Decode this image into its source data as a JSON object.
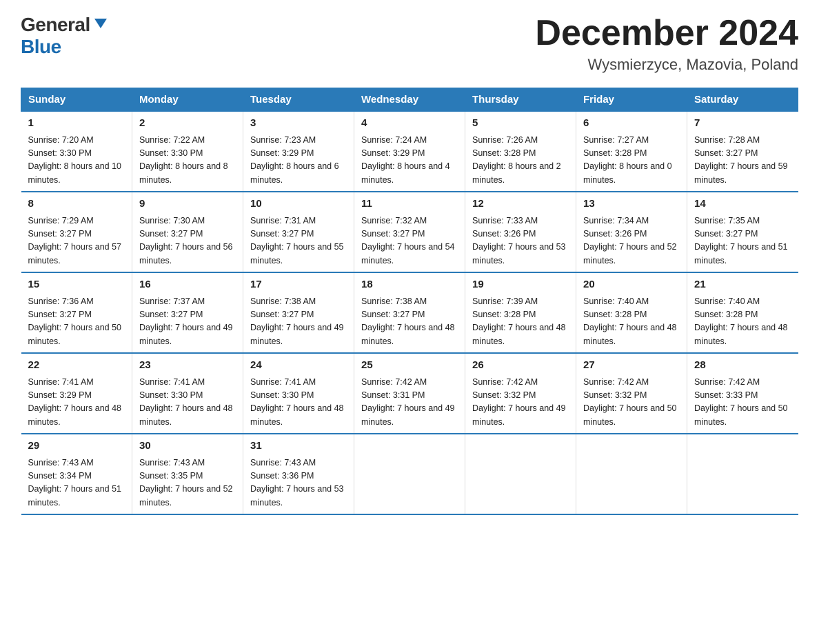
{
  "logo": {
    "general": "General",
    "blue": "Blue"
  },
  "title": "December 2024",
  "location": "Wysmierzyce, Mazovia, Poland",
  "days_of_week": [
    "Sunday",
    "Monday",
    "Tuesday",
    "Wednesday",
    "Thursday",
    "Friday",
    "Saturday"
  ],
  "weeks": [
    [
      {
        "day": "1",
        "sunrise": "Sunrise: 7:20 AM",
        "sunset": "Sunset: 3:30 PM",
        "daylight": "Daylight: 8 hours and 10 minutes."
      },
      {
        "day": "2",
        "sunrise": "Sunrise: 7:22 AM",
        "sunset": "Sunset: 3:30 PM",
        "daylight": "Daylight: 8 hours and 8 minutes."
      },
      {
        "day": "3",
        "sunrise": "Sunrise: 7:23 AM",
        "sunset": "Sunset: 3:29 PM",
        "daylight": "Daylight: 8 hours and 6 minutes."
      },
      {
        "day": "4",
        "sunrise": "Sunrise: 7:24 AM",
        "sunset": "Sunset: 3:29 PM",
        "daylight": "Daylight: 8 hours and 4 minutes."
      },
      {
        "day": "5",
        "sunrise": "Sunrise: 7:26 AM",
        "sunset": "Sunset: 3:28 PM",
        "daylight": "Daylight: 8 hours and 2 minutes."
      },
      {
        "day": "6",
        "sunrise": "Sunrise: 7:27 AM",
        "sunset": "Sunset: 3:28 PM",
        "daylight": "Daylight: 8 hours and 0 minutes."
      },
      {
        "day": "7",
        "sunrise": "Sunrise: 7:28 AM",
        "sunset": "Sunset: 3:27 PM",
        "daylight": "Daylight: 7 hours and 59 minutes."
      }
    ],
    [
      {
        "day": "8",
        "sunrise": "Sunrise: 7:29 AM",
        "sunset": "Sunset: 3:27 PM",
        "daylight": "Daylight: 7 hours and 57 minutes."
      },
      {
        "day": "9",
        "sunrise": "Sunrise: 7:30 AM",
        "sunset": "Sunset: 3:27 PM",
        "daylight": "Daylight: 7 hours and 56 minutes."
      },
      {
        "day": "10",
        "sunrise": "Sunrise: 7:31 AM",
        "sunset": "Sunset: 3:27 PM",
        "daylight": "Daylight: 7 hours and 55 minutes."
      },
      {
        "day": "11",
        "sunrise": "Sunrise: 7:32 AM",
        "sunset": "Sunset: 3:27 PM",
        "daylight": "Daylight: 7 hours and 54 minutes."
      },
      {
        "day": "12",
        "sunrise": "Sunrise: 7:33 AM",
        "sunset": "Sunset: 3:26 PM",
        "daylight": "Daylight: 7 hours and 53 minutes."
      },
      {
        "day": "13",
        "sunrise": "Sunrise: 7:34 AM",
        "sunset": "Sunset: 3:26 PM",
        "daylight": "Daylight: 7 hours and 52 minutes."
      },
      {
        "day": "14",
        "sunrise": "Sunrise: 7:35 AM",
        "sunset": "Sunset: 3:27 PM",
        "daylight": "Daylight: 7 hours and 51 minutes."
      }
    ],
    [
      {
        "day": "15",
        "sunrise": "Sunrise: 7:36 AM",
        "sunset": "Sunset: 3:27 PM",
        "daylight": "Daylight: 7 hours and 50 minutes."
      },
      {
        "day": "16",
        "sunrise": "Sunrise: 7:37 AM",
        "sunset": "Sunset: 3:27 PM",
        "daylight": "Daylight: 7 hours and 49 minutes."
      },
      {
        "day": "17",
        "sunrise": "Sunrise: 7:38 AM",
        "sunset": "Sunset: 3:27 PM",
        "daylight": "Daylight: 7 hours and 49 minutes."
      },
      {
        "day": "18",
        "sunrise": "Sunrise: 7:38 AM",
        "sunset": "Sunset: 3:27 PM",
        "daylight": "Daylight: 7 hours and 48 minutes."
      },
      {
        "day": "19",
        "sunrise": "Sunrise: 7:39 AM",
        "sunset": "Sunset: 3:28 PM",
        "daylight": "Daylight: 7 hours and 48 minutes."
      },
      {
        "day": "20",
        "sunrise": "Sunrise: 7:40 AM",
        "sunset": "Sunset: 3:28 PM",
        "daylight": "Daylight: 7 hours and 48 minutes."
      },
      {
        "day": "21",
        "sunrise": "Sunrise: 7:40 AM",
        "sunset": "Sunset: 3:28 PM",
        "daylight": "Daylight: 7 hours and 48 minutes."
      }
    ],
    [
      {
        "day": "22",
        "sunrise": "Sunrise: 7:41 AM",
        "sunset": "Sunset: 3:29 PM",
        "daylight": "Daylight: 7 hours and 48 minutes."
      },
      {
        "day": "23",
        "sunrise": "Sunrise: 7:41 AM",
        "sunset": "Sunset: 3:30 PM",
        "daylight": "Daylight: 7 hours and 48 minutes."
      },
      {
        "day": "24",
        "sunrise": "Sunrise: 7:41 AM",
        "sunset": "Sunset: 3:30 PM",
        "daylight": "Daylight: 7 hours and 48 minutes."
      },
      {
        "day": "25",
        "sunrise": "Sunrise: 7:42 AM",
        "sunset": "Sunset: 3:31 PM",
        "daylight": "Daylight: 7 hours and 49 minutes."
      },
      {
        "day": "26",
        "sunrise": "Sunrise: 7:42 AM",
        "sunset": "Sunset: 3:32 PM",
        "daylight": "Daylight: 7 hours and 49 minutes."
      },
      {
        "day": "27",
        "sunrise": "Sunrise: 7:42 AM",
        "sunset": "Sunset: 3:32 PM",
        "daylight": "Daylight: 7 hours and 50 minutes."
      },
      {
        "day": "28",
        "sunrise": "Sunrise: 7:42 AM",
        "sunset": "Sunset: 3:33 PM",
        "daylight": "Daylight: 7 hours and 50 minutes."
      }
    ],
    [
      {
        "day": "29",
        "sunrise": "Sunrise: 7:43 AM",
        "sunset": "Sunset: 3:34 PM",
        "daylight": "Daylight: 7 hours and 51 minutes."
      },
      {
        "day": "30",
        "sunrise": "Sunrise: 7:43 AM",
        "sunset": "Sunset: 3:35 PM",
        "daylight": "Daylight: 7 hours and 52 minutes."
      },
      {
        "day": "31",
        "sunrise": "Sunrise: 7:43 AM",
        "sunset": "Sunset: 3:36 PM",
        "daylight": "Daylight: 7 hours and 53 minutes."
      },
      null,
      null,
      null,
      null
    ]
  ]
}
